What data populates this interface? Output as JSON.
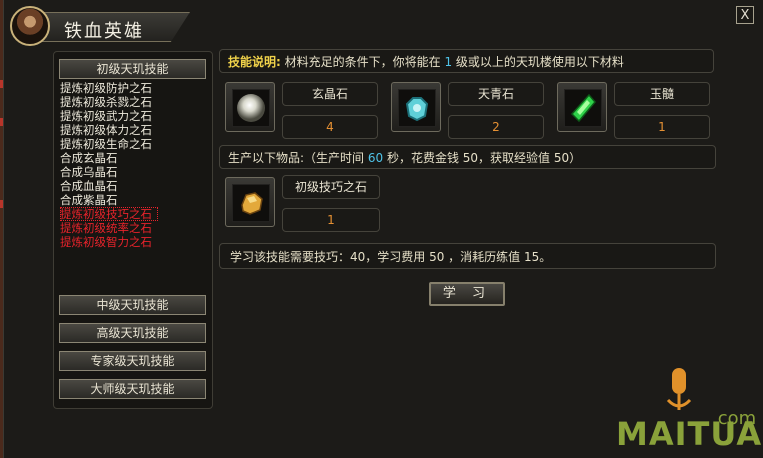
{
  "window": {
    "title": "铁血英雄",
    "close_glyph": "X"
  },
  "skill_tabs": {
    "basic": "初级天玑技能",
    "intermediate": "中级天玑技能",
    "advanced": "高级天玑技能",
    "expert": "专家级天玑技能",
    "master": "大师级天玑技能"
  },
  "skill_list": [
    {
      "label": "提炼初级防护之石",
      "color": "#eeeadc"
    },
    {
      "label": "提炼初级杀戮之石",
      "color": "#eeeadc"
    },
    {
      "label": "提炼初级武力之石",
      "color": "#eeeadc"
    },
    {
      "label": "提炼初级体力之石",
      "color": "#eeeadc"
    },
    {
      "label": "提炼初级生命之石",
      "color": "#eeeadc"
    },
    {
      "label": "合成玄晶石",
      "color": "#eeeadc"
    },
    {
      "label": "合成乌晶石",
      "color": "#eeeadc"
    },
    {
      "label": "合成血晶石",
      "color": "#eeeadc"
    },
    {
      "label": "合成紫晶石",
      "color": "#eeeadc"
    },
    {
      "label": "提炼初级技巧之石",
      "color": "#e8232b",
      "selected": true
    },
    {
      "label": "提炼初级统率之石",
      "color": "#e8232b"
    },
    {
      "label": "提炼初级智力之石",
      "color": "#e8232b"
    }
  ],
  "description": {
    "label": "技能说明:",
    "text_before": " 材料充足的条件下，你将能在 ",
    "level": "1",
    "text_after": " 级或以上的天玑楼使用以下材料"
  },
  "materials": [
    {
      "icon": "crystal-orb-icon",
      "name": "玄晶石",
      "count": "4"
    },
    {
      "icon": "blue-gem-icon",
      "name": "天青石",
      "count": "2"
    },
    {
      "icon": "green-jade-icon",
      "name": "玉髓",
      "count": "1"
    }
  ],
  "production": {
    "text_1": "生产以下物品:（生产时间 ",
    "time": "60",
    "text_2": " 秒，花费金钱 50，获取经验值 50）"
  },
  "product": {
    "icon": "gold-stone-icon",
    "name": "初级技巧之石",
    "count": "1"
  },
  "requirement": "学习该技能需要技巧：40，学习费用 50 ，消耗历练值 15。",
  "learn_button": "学 习",
  "watermark": {
    "main": "MAITUAN",
    "suffix": ".com"
  }
}
